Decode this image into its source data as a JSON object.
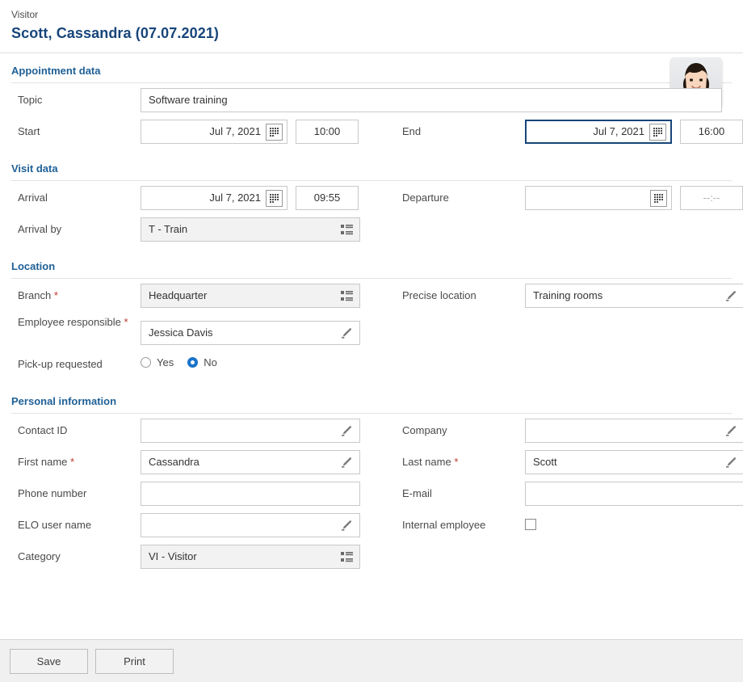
{
  "header": {
    "kind": "Visitor",
    "title": "Scott, Cassandra (07.07.2021)",
    "avatar_name": "visitor-photo"
  },
  "colors": {
    "section_title": "#1f6096",
    "page_title": "#17457a",
    "required_marker": "#c0392b",
    "radio_selected": "#1a73c8",
    "focus_border": "#17457a",
    "readonly_bg": "#f2f2f2",
    "footer_bg": "#f0f0f0"
  },
  "sections": {
    "appointment": {
      "title": "Appointment data",
      "topic": {
        "label": "Topic",
        "value": "Software training"
      },
      "start": {
        "label": "Start",
        "date": "Jul 7, 2021",
        "time": "10:00",
        "calendar_icon": "calendar-icon"
      },
      "end": {
        "label": "End",
        "date": "Jul 7, 2021",
        "time": "16:00",
        "calendar_icon": "calendar-icon"
      }
    },
    "visit": {
      "title": "Visit data",
      "arrival": {
        "label": "Arrival",
        "date": "Jul 7, 2021",
        "time": "09:55"
      },
      "departure": {
        "label": "Departure",
        "date": "",
        "time_placeholder": "--:--"
      },
      "arrival_by": {
        "label": "Arrival by",
        "value": "T - Train",
        "icon": "list-lookup-icon"
      }
    },
    "location": {
      "title": "Location",
      "branch": {
        "label": "Branch",
        "required": "*",
        "value": "Headquarter",
        "icon": "list-lookup-icon"
      },
      "precise_location": {
        "label": "Precise location",
        "value": "Training rooms",
        "icon": "pencil-icon"
      },
      "employee_responsible": {
        "label": "Employee responsible",
        "required": "*",
        "value": "Jessica Davis",
        "icon": "pencil-icon"
      },
      "pickup": {
        "label": "Pick-up requested",
        "options": [
          {
            "label": "Yes",
            "selected": false
          },
          {
            "label": "No",
            "selected": true
          }
        ]
      }
    },
    "personal": {
      "title": "Personal information",
      "contact_id": {
        "label": "Contact ID",
        "value": "",
        "icon": "pencil-icon"
      },
      "company": {
        "label": "Company",
        "value": "",
        "icon": "pencil-icon"
      },
      "first_name": {
        "label": "First name",
        "required": "*",
        "value": "Cassandra",
        "icon": "pencil-icon"
      },
      "last_name": {
        "label": "Last name",
        "required": "*",
        "value": "Scott",
        "icon": "pencil-icon"
      },
      "phone_number": {
        "label": "Phone number",
        "value": ""
      },
      "email": {
        "label": "E-mail",
        "value": ""
      },
      "elo_user_name": {
        "label": "ELO user name",
        "value": "",
        "icon": "pencil-icon"
      },
      "internal_employee": {
        "label": "Internal employee",
        "checked": false
      },
      "category": {
        "label": "Category",
        "value": "VI - Visitor",
        "icon": "list-lookup-icon"
      }
    }
  },
  "footer": {
    "save_label": "Save",
    "print_label": "Print"
  }
}
